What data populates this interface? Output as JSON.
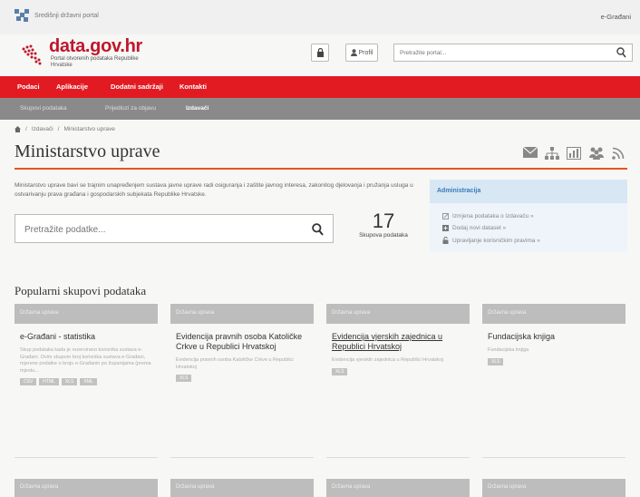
{
  "govbar": {
    "text": "Središnji državni portal",
    "right": "e-Građani"
  },
  "header": {
    "logo_title": "data.gov.hr",
    "logo_sub": "Portal otvorenih podataka Republike Hrvatske",
    "profil": "Profil",
    "search_placeholder": "Pretražite portal..."
  },
  "nav": [
    "Podaci",
    "Aplikacije",
    "Dodatni sadržaji",
    "Kontakti"
  ],
  "subnav": [
    "Skupovi podataka",
    "Prijedlozi za objavu",
    "Izdavači"
  ],
  "breadcrumb": [
    "Izdavači",
    "Ministarstvo uprave"
  ],
  "page_title": "Ministarstvo uprave",
  "description": "Ministarstvo uprave bavi se trajnim unapređenjem sustava javne uprave radi osiguranja i zaštite javnog interesa, zakonitog djelovanja i pružanja usluga u ostvarivanju prava građana i gospodarskih subjekata Republike Hrvatske.",
  "search": {
    "placeholder": "Pretražite podatke..."
  },
  "count": {
    "value": "17",
    "label": "Skupova podataka"
  },
  "admin": {
    "title": "Administracija",
    "links": [
      "Izmjena podataka o izdavaču »",
      "Dodaj novi dataset »",
      "Upravljanje korisničkim pravima »"
    ]
  },
  "popular_title": "Popularni skupovi podataka",
  "cards": [
    {
      "bar": "Državna uprava",
      "title": "e-Građani - statistika",
      "desc": "Skup podataka kada je rezervirano korisnika sustava e-Građani. Ovim skupom broj korisnika sustava e-Građani, mjerene podatke o broju e-Građanin po županijama (prema mjestu...",
      "tags": [
        "CSV",
        "HTML",
        "XLS",
        "XML"
      ]
    },
    {
      "bar": "Državna uprava",
      "title": "Evidencija pravnih osoba Katoličke Crkve u Republici Hrvatskoj",
      "desc": "Evidencija pravnih osoba Katoličke Crkve u Republici Hrvatskoj",
      "tags": [
        "XLS"
      ]
    },
    {
      "bar": "Državna uprava",
      "title": "Evidencija vjerskih zajednica u Republici Hrvatskoj",
      "desc": "Evidencija vjerskih zajednica u Republici Hrvatskoj",
      "tags": [
        "XLS"
      ]
    },
    {
      "bar": "Državna uprava",
      "title": "Fundacijska knjiga",
      "desc": "Fundacijska knjiga",
      "tags": [
        "XLS"
      ]
    }
  ],
  "cards_bottom": [
    "Državna uprava",
    "Državna uprava",
    "Državna uprava",
    "Državna uprava"
  ]
}
